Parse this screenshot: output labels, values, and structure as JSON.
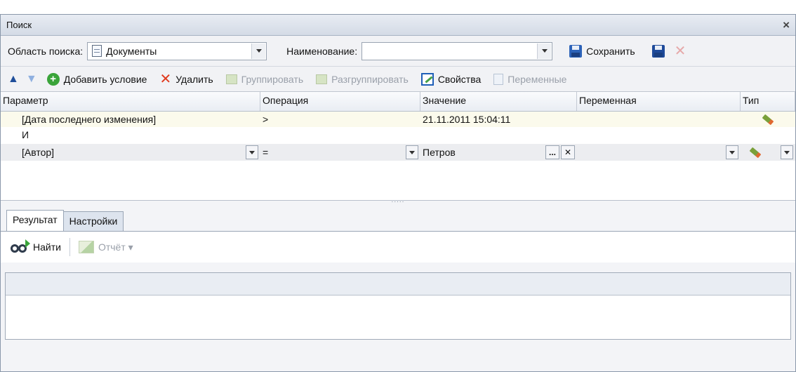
{
  "window": {
    "title": "Поиск",
    "close": "×"
  },
  "search": {
    "area_label": "Область поиска:",
    "area_value": "Документы",
    "name_label": "Наименование:",
    "name_value": "",
    "save_label": "Сохранить"
  },
  "toolbar": {
    "add": "Добавить условие",
    "delete": "Удалить",
    "group": "Группировать",
    "ungroup": "Разгруппировать",
    "props": "Свойства",
    "vars": "Переменные"
  },
  "grid": {
    "headers": [
      "Параметр",
      "Операция",
      "Значение",
      "Переменная",
      "Тип"
    ],
    "rows": [
      {
        "param": "[Дата последнего изменения]",
        "op": ">",
        "value": "21.11.2011 15:04:11",
        "var": ""
      },
      {
        "param": "И",
        "op": "",
        "value": "",
        "var": ""
      },
      {
        "param": "[Автор]",
        "op": "=",
        "value": "Петров",
        "var": ""
      }
    ],
    "ellipsis": "...",
    "clear": "✕",
    "splitter": "....."
  },
  "bottom": {
    "tabs": [
      "Результат",
      "Настройки"
    ],
    "find": "Найти",
    "report": "Отчёт ▾"
  },
  "colors": {
    "titlebar": "#d4dbe6",
    "accent": "#2c62b8"
  }
}
